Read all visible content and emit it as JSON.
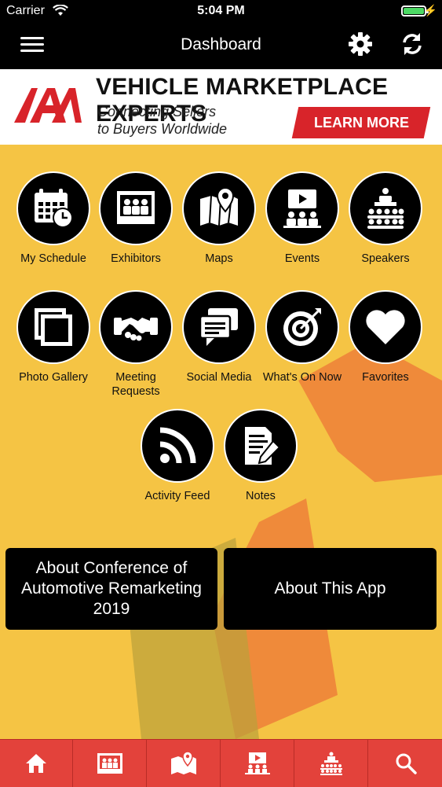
{
  "status_bar": {
    "carrier": "Carrier",
    "time": "5:04 PM"
  },
  "nav": {
    "title": "Dashboard"
  },
  "banner": {
    "logo_text": "IAA",
    "headline": "VEHICLE MARKETPLACE EXPERTS",
    "sub1": "Connecting Sellers",
    "sub2": "to Buyers Worldwide",
    "cta": "LEARN MORE"
  },
  "tiles": [
    {
      "label": "My Schedule",
      "icon": "calendar-clock-icon"
    },
    {
      "label": "Exhibitors",
      "icon": "booth-icon"
    },
    {
      "label": "Maps",
      "icon": "map-pin-icon"
    },
    {
      "label": "Events",
      "icon": "presentation-icon"
    },
    {
      "label": "Speakers",
      "icon": "podium-audience-icon"
    },
    {
      "label": "Photo Gallery",
      "icon": "photos-icon"
    },
    {
      "label": "Meeting Requests",
      "icon": "handshake-icon"
    },
    {
      "label": "Social Media",
      "icon": "chat-bubbles-icon"
    },
    {
      "label": "What's On Now",
      "icon": "target-icon"
    },
    {
      "label": "Favorites",
      "icon": "heart-icon"
    },
    {
      "label": "Activity Feed",
      "icon": "rss-icon"
    },
    {
      "label": "Notes",
      "icon": "note-pencil-icon"
    }
  ],
  "about": {
    "conference": "About Conference of Automotive Remarketing 2019",
    "app": "About This App"
  },
  "tabbar": [
    "home-icon",
    "booth-icon",
    "map-pin-icon",
    "presentation-icon",
    "podium-audience-icon",
    "search-icon"
  ],
  "colors": {
    "background": "#f5c444",
    "tabbar": "#e3423b",
    "cta": "#d8242a"
  }
}
